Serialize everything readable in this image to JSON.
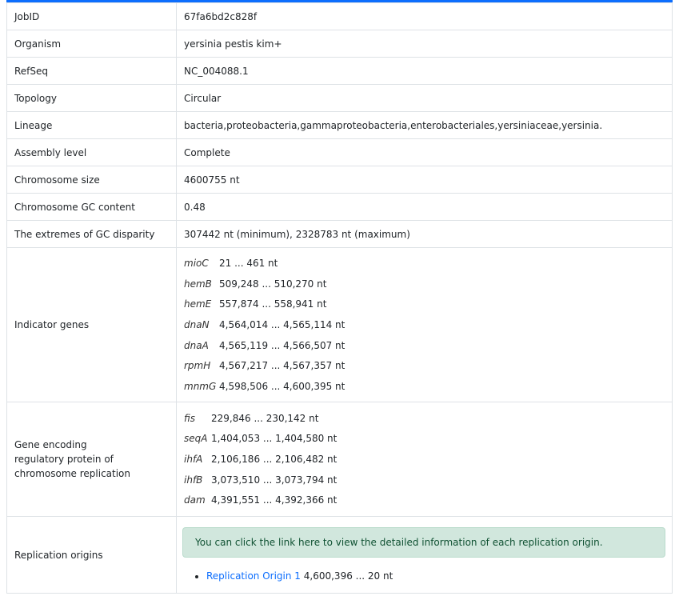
{
  "rows": [
    {
      "key": "JobID",
      "value": "67fa6bd2c828f"
    },
    {
      "key": "Organism",
      "value": "yersinia pestis kim+"
    },
    {
      "key": "RefSeq",
      "value": "NC_004088.1"
    },
    {
      "key": "Topology",
      "value": "Circular"
    },
    {
      "key": "Lineage",
      "value": "bacteria,proteobacteria,gammaproteobacteria,enterobacteriales,yersiniaceae,yersinia."
    },
    {
      "key": "Assembly level",
      "value": "Complete"
    },
    {
      "key": "Chromosome size",
      "value": "4600755 nt"
    },
    {
      "key": "Chromosome GC content",
      "value": "0.48"
    },
    {
      "key": "The extremes of GC disparity",
      "value": "307442 nt (minimum), 2328783 nt (maximum)"
    }
  ],
  "indicator": {
    "key": "Indicator genes",
    "genes": [
      {
        "name": "mioC",
        "range": "21 ... 461 nt"
      },
      {
        "name": "hemB",
        "range": "509,248 ... 510,270 nt"
      },
      {
        "name": "hemE",
        "range": "557,874 ... 558,941 nt"
      },
      {
        "name": "dnaN",
        "range": "4,564,014 ... 4,565,114 nt"
      },
      {
        "name": "dnaA",
        "range": "4,565,119 ... 4,566,507 nt"
      },
      {
        "name": "rpmH",
        "range": "4,567,217 ... 4,567,357 nt"
      },
      {
        "name": "mnmG",
        "range": "4,598,506 ... 4,600,395 nt"
      }
    ]
  },
  "encoding": {
    "key_lines": [
      "Gene encoding",
      "regulatory protein of",
      "chromosome replication"
    ],
    "genes": [
      {
        "name": "fis",
        "range": "229,846 ... 230,142 nt"
      },
      {
        "name": "seqA",
        "range": "1,404,053 ... 1,404,580 nt"
      },
      {
        "name": "ihfA",
        "range": "2,106,186 ... 2,106,482 nt"
      },
      {
        "name": "ihfB",
        "range": "3,073,510 ... 3,073,794 nt"
      },
      {
        "name": "dam",
        "range": "4,391,551 ... 4,392,366 nt"
      }
    ]
  },
  "origins": {
    "key": "Replication origins",
    "alert": "You can click the link here to view the detailed information of each replication origin.",
    "items": [
      {
        "link": "Replication Origin 1",
        "range": "4,600,396 ... 20 nt"
      }
    ]
  },
  "colors": {
    "border": "#dee2e6",
    "alert_bg": "#d1e7dd",
    "alert_text": "#0f5132",
    "link": "#0d6efd"
  }
}
